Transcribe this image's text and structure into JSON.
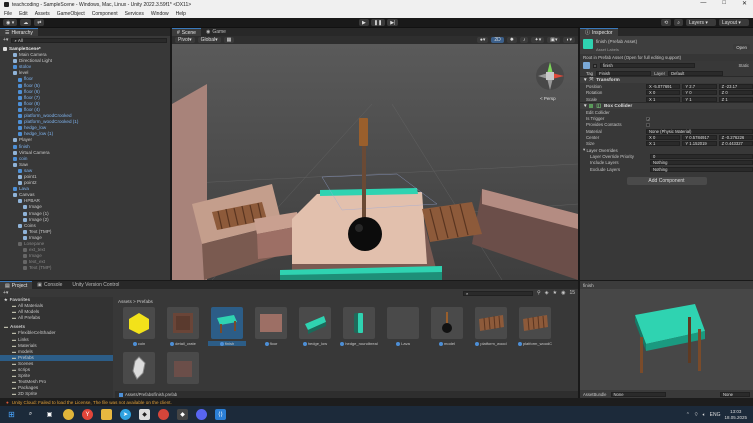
{
  "window": {
    "title": "teachcoding - SampleScene - Windows, Mac, Linux - Unity 2022.3.59f1* <DX11>",
    "controls": [
      "—",
      "□",
      "✕"
    ]
  },
  "menu": [
    "File",
    "Edit",
    "Assets",
    "GameObject",
    "Component",
    "Services",
    "Window",
    "Help"
  ],
  "toolbar": {
    "account": "teachcoding",
    "layers": "Layers",
    "layout": "Layout",
    "play": "▶",
    "pause": "❚❚",
    "step": "▶|"
  },
  "hierarchy": {
    "tab": "Hierarchy",
    "search_placeholder": "All",
    "items": [
      {
        "label": "SampleScene*",
        "indent": 0,
        "style": "scene"
      },
      {
        "label": "Main Camera",
        "indent": 2,
        "style": ""
      },
      {
        "label": "Directional Light",
        "indent": 2,
        "style": ""
      },
      {
        "label": "stolov",
        "indent": 2,
        "style": "blue"
      },
      {
        "label": "level",
        "indent": 2,
        "style": ""
      },
      {
        "label": "floor",
        "indent": 3,
        "style": "blue"
      },
      {
        "label": "floor (5)",
        "indent": 3,
        "style": "blue"
      },
      {
        "label": "floor (6)",
        "indent": 3,
        "style": "blue"
      },
      {
        "label": "floor (7)",
        "indent": 3,
        "style": "blue"
      },
      {
        "label": "floor (8)",
        "indent": 3,
        "style": "blue"
      },
      {
        "label": "floor (4)",
        "indent": 3,
        "style": "blue"
      },
      {
        "label": "platform_woodCrooked",
        "indent": 3,
        "style": "blue"
      },
      {
        "label": "platform_woodCrooked (1)",
        "indent": 3,
        "style": "blue"
      },
      {
        "label": "hedge_low",
        "indent": 3,
        "style": "blue"
      },
      {
        "label": "hedge_low (1)",
        "indent": 3,
        "style": "blue"
      },
      {
        "label": "Player",
        "indent": 2,
        "style": ""
      },
      {
        "label": "finish",
        "indent": 2,
        "style": "blue"
      },
      {
        "label": "Virtual Camera",
        "indent": 2,
        "style": ""
      },
      {
        "label": "coin",
        "indent": 2,
        "style": "blue"
      },
      {
        "label": "Saw",
        "indent": 2,
        "style": ""
      },
      {
        "label": "saw",
        "indent": 3,
        "style": "blue"
      },
      {
        "label": "point1",
        "indent": 3,
        "style": ""
      },
      {
        "label": "point2",
        "indent": 3,
        "style": ""
      },
      {
        "label": "Lava",
        "indent": 2,
        "style": "blue"
      },
      {
        "label": "Canvas",
        "indent": 2,
        "style": ""
      },
      {
        "label": "HPBAR",
        "indent": 3,
        "style": ""
      },
      {
        "label": "Image",
        "indent": 4,
        "style": ""
      },
      {
        "label": "Image (1)",
        "indent": 4,
        "style": ""
      },
      {
        "label": "Image (2)",
        "indent": 4,
        "style": ""
      },
      {
        "label": "Coins",
        "indent": 3,
        "style": ""
      },
      {
        "label": "Text (TMP)",
        "indent": 4,
        "style": ""
      },
      {
        "label": "Image",
        "indent": 4,
        "style": ""
      },
      {
        "label": "Losepane",
        "indent": 3,
        "style": "dim"
      },
      {
        "label": "ext_text",
        "indent": 4,
        "style": "dim"
      },
      {
        "label": "Image",
        "indent": 4,
        "style": "dim"
      },
      {
        "label": "text_ext",
        "indent": 4,
        "style": "dim"
      },
      {
        "label": "Text (TMP)",
        "indent": 4,
        "style": "dim"
      }
    ]
  },
  "scene": {
    "tabs": [
      "Scene",
      "Game"
    ],
    "pivot": "Pivot",
    "space": "Global",
    "gizmo_label": "< Persp",
    "zoom": "2D"
  },
  "inspector": {
    "tab": "Inspector",
    "header_name": "finish (Prefab Asset)",
    "open_button": "Open",
    "asset_labels": "Asset Labels",
    "root_notice": "Root in Prefab Asset (Open for full editing support)",
    "object_name": "finish",
    "static_label": "Static",
    "tag_label": "Tag",
    "tag_value": "Finish",
    "layer_label": "Layer",
    "layer_value": "Default",
    "transform": {
      "title": "Transform",
      "position": {
        "label": "Position",
        "x": "-5.077691",
        "y": "2.7",
        "z": "-23.17"
      },
      "rotation": {
        "label": "Rotation",
        "x": "0",
        "y": "0",
        "z": "0"
      },
      "scale": {
        "label": "Scale",
        "x": "1",
        "y": "1",
        "z": "1"
      }
    },
    "box_collider": {
      "title": "Box Collider",
      "edit_collider": "Edit Collider",
      "is_trigger": "Is Trigger",
      "provides_contacts": "Provides Contacts",
      "material_label": "Material",
      "material_value": "None (Physic Material)",
      "center": {
        "label": "Center",
        "x": "0",
        "y": "0.5784917",
        "z": "-0.276226"
      },
      "size": {
        "label": "Size",
        "x": "1",
        "y": "1.152019",
        "z": "0.443327"
      },
      "layer_overrides": "Layer Overrides",
      "layer_override_priority": "Layer Override Priority",
      "priority_value": "0",
      "include_layers": "Include Layers",
      "include_value": "Nothing",
      "exclude_layers": "Exclude Layers",
      "exclude_value": "Nothing"
    },
    "add_component": "Add Component"
  },
  "project": {
    "tabs": [
      "Project",
      "Console",
      "Unity Version Control"
    ],
    "breadcrumb": "Assets > Prefabs",
    "count": "15",
    "favorites": [
      "Favorites",
      "All Materials",
      "All Models",
      "All Prefabs"
    ],
    "assets_tree": [
      "Assets",
      "FlexibleCelShader",
      "Links",
      "Materials",
      "models",
      "Prefabs",
      "Scenes",
      "scrips",
      "Sprite",
      "TextMesh Pro",
      "Packages",
      "2D Sprite"
    ],
    "assets": [
      {
        "label": "coin",
        "thumb": "coin"
      },
      {
        "label": "detail_crate",
        "thumb": "crate"
      },
      {
        "label": "finish",
        "thumb": "finish"
      },
      {
        "label": "floor",
        "thumb": "floor"
      },
      {
        "label": "hedge_low",
        "thumb": "hedge"
      },
      {
        "label": "hedge_roundbreal",
        "thumb": "hedge2"
      },
      {
        "label": "Lava",
        "thumb": "empty"
      },
      {
        "label": "model",
        "thumb": "model"
      },
      {
        "label": "platform_wood",
        "thumb": "plank"
      },
      {
        "label": "platform_woodC",
        "thumb": "plank"
      },
      {
        "label": "",
        "thumb": "saw"
      },
      {
        "label": "",
        "thumb": "block"
      }
    ],
    "footer_path": "Assets/Prefabs/finish.prefab"
  },
  "preview": {
    "title": "finish",
    "assetbundle_label": "AssetBundle",
    "assetbundle_value": "None",
    "variant_value": "None"
  },
  "status": {
    "message": "Unity Cloud: Failed to load the License, The file was not available on the client."
  },
  "taskbar": {
    "lang": "ENG",
    "time": "13:03",
    "date": "18.05.2025"
  },
  "colors": {
    "accent": "#3a79bb",
    "teal": "#2fd3b1",
    "wood": "#7a4b2a"
  }
}
